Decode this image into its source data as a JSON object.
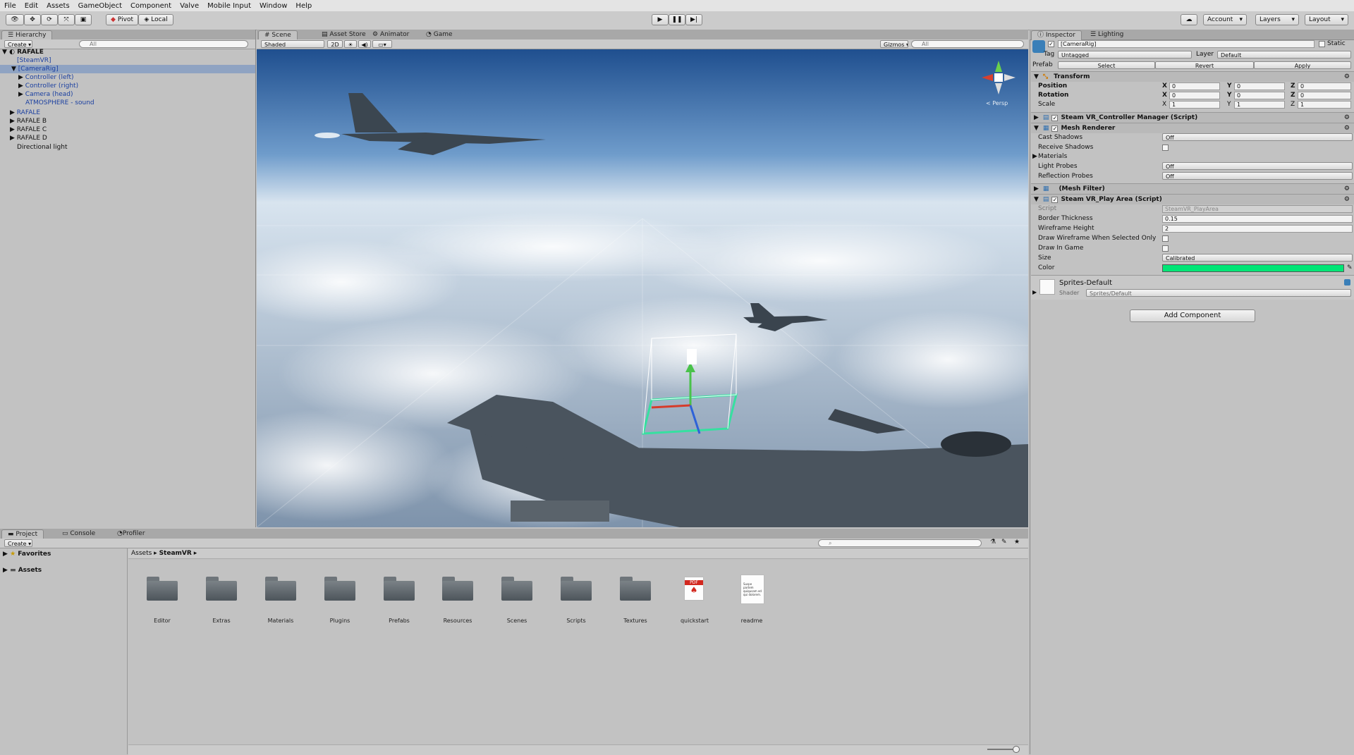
{
  "menu": [
    "File",
    "Edit",
    "Assets",
    "GameObject",
    "Component",
    "Valve",
    "Mobile Input",
    "Window",
    "Help"
  ],
  "toolbar": {
    "pivot": "Pivot",
    "local": "Local",
    "account": "Account",
    "layers": "Layers",
    "layout": "Layout"
  },
  "hierarchy": {
    "tab": "Hierarchy",
    "create": "Create",
    "search_placeholder": "All",
    "scene": "RAFALE",
    "items": [
      "[SteamVR]",
      "[CameraRig]",
      "Controller (left)",
      "Controller (right)",
      "Camera (head)",
      "ATMOSPHERE - sound",
      "RAFALE",
      "RAFALE B",
      "RAFALE C",
      "RAFALE D",
      "Directional light"
    ]
  },
  "scene": {
    "tabs": [
      "Scene",
      "Asset Store",
      "Animator",
      "Game"
    ],
    "shaded": "Shaded",
    "mode2d": "2D",
    "gizmos": "Gizmos",
    "search_placeholder": "All",
    "persp": "< Persp"
  },
  "inspector": {
    "tabs": [
      "Inspector",
      "Lighting"
    ],
    "object_name": "[CameraRig]",
    "static": "Static",
    "tag_label": "Tag",
    "tag": "Untagged",
    "layer_label": "Layer",
    "layer": "Default",
    "prefab_label": "Prefab",
    "prefab_select": "Select",
    "prefab_revert": "Revert",
    "prefab_apply": "Apply",
    "transform": {
      "title": "Transform",
      "position": "Position",
      "rotation": "Rotation",
      "scale": "Scale",
      "pos": [
        "0",
        "0",
        "0"
      ],
      "rot": [
        "0",
        "0",
        "0"
      ],
      "scl": [
        "1",
        "1",
        "1"
      ],
      "x": "X",
      "y": "Y",
      "z": "Z"
    },
    "controller_manager": "Steam VR_Controller Manager (Script)",
    "mesh_renderer": {
      "title": "Mesh Renderer",
      "cast_shadows": "Cast Shadows",
      "cast_shadows_val": "Off",
      "receive_shadows": "Receive Shadows",
      "materials": "Materials",
      "light_probes": "Light Probes",
      "light_probes_val": "Off",
      "reflection_probes": "Reflection Probes",
      "reflection_probes_val": "Off"
    },
    "mesh_filter": "(Mesh Filter)",
    "play_area": {
      "title": "Steam VR_Play Area (Script)",
      "script": "Script",
      "script_val": "SteamVR_PlayArea",
      "border": "Border Thickness",
      "border_val": "0.15",
      "wire": "Wireframe Height",
      "wire_val": "2",
      "draw_sel": "Draw Wireframe When Selected Only",
      "draw_game": "Draw In Game",
      "size": "Size",
      "size_val": "Calibrated",
      "color": "Color",
      "color_val": "#00e676"
    },
    "material": {
      "name": "Sprites-Default",
      "shader_label": "Shader",
      "shader": "Sprites/Default"
    },
    "add_component": "Add Component"
  },
  "project": {
    "tabs": [
      "Project",
      "Console",
      "Profiler"
    ],
    "create": "Create",
    "favorites": "Favorites",
    "assets": "Assets",
    "breadcrumb": [
      "Assets",
      "SteamVR"
    ],
    "items": [
      "Editor",
      "Extras",
      "Materials",
      "Plugins",
      "Prefabs",
      "Resources",
      "Scenes",
      "Scripts",
      "Textures",
      "quickstart",
      "readme"
    ],
    "pdf_label": "PDF",
    "readme_text": "Suspe partem quiqusam ed qui dolorem."
  }
}
